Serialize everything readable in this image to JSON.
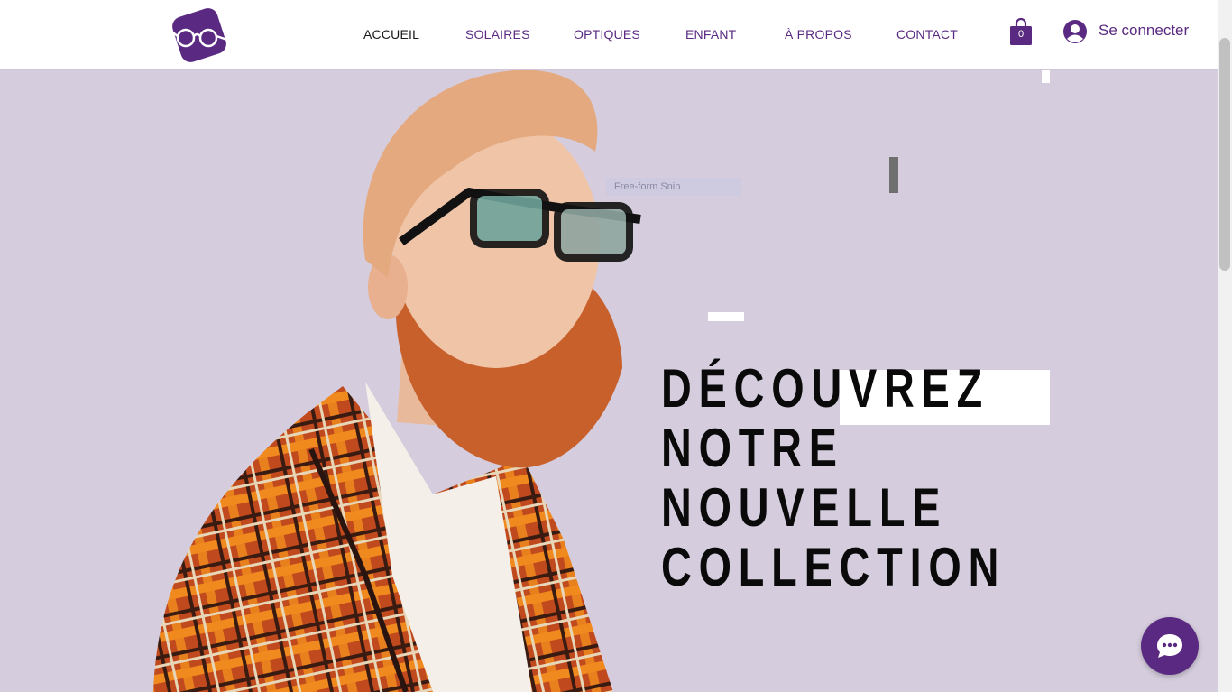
{
  "nav": {
    "items": [
      {
        "label": "ACCUEIL"
      },
      {
        "label": "SOLAIRES"
      },
      {
        "label": "OPTIQUES"
      },
      {
        "label": "ENFANT"
      },
      {
        "label": "À PROPOS"
      },
      {
        "label": "CONTACT"
      }
    ],
    "active": "ACCUEIL"
  },
  "cart": {
    "count": "0",
    "icon": "shopping-bag-icon"
  },
  "login": {
    "label": "Se connecter",
    "icon": "user-avatar-icon"
  },
  "overlay": {
    "snip_label": "Free-form Snip"
  },
  "hero": {
    "headline": [
      "DÉCOUVREZ",
      "NOTRE",
      "NOUVELLE",
      "COLLECTION"
    ],
    "image_subject": "man with red beard and glasses in plaid jacket"
  },
  "chat": {
    "icon": "chat-bubble-icon"
  },
  "colors": {
    "brand": "#5a2a82",
    "hero_background": "#d5cddd",
    "header_background": "#ffffff",
    "headline": "#0a0a0a"
  }
}
